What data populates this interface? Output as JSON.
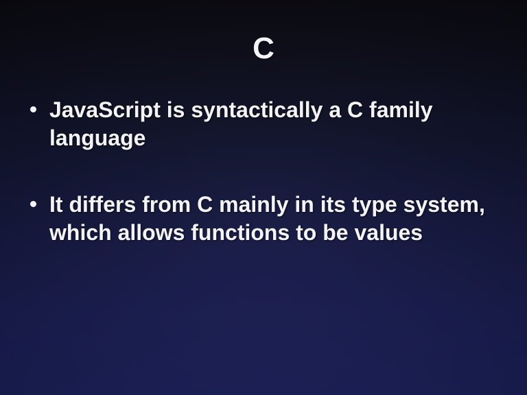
{
  "slide": {
    "title": "C",
    "bullets": [
      "JavaScript is syntactically a C family language",
      "It differs from C mainly in its type system, which allows functions to be values"
    ]
  }
}
